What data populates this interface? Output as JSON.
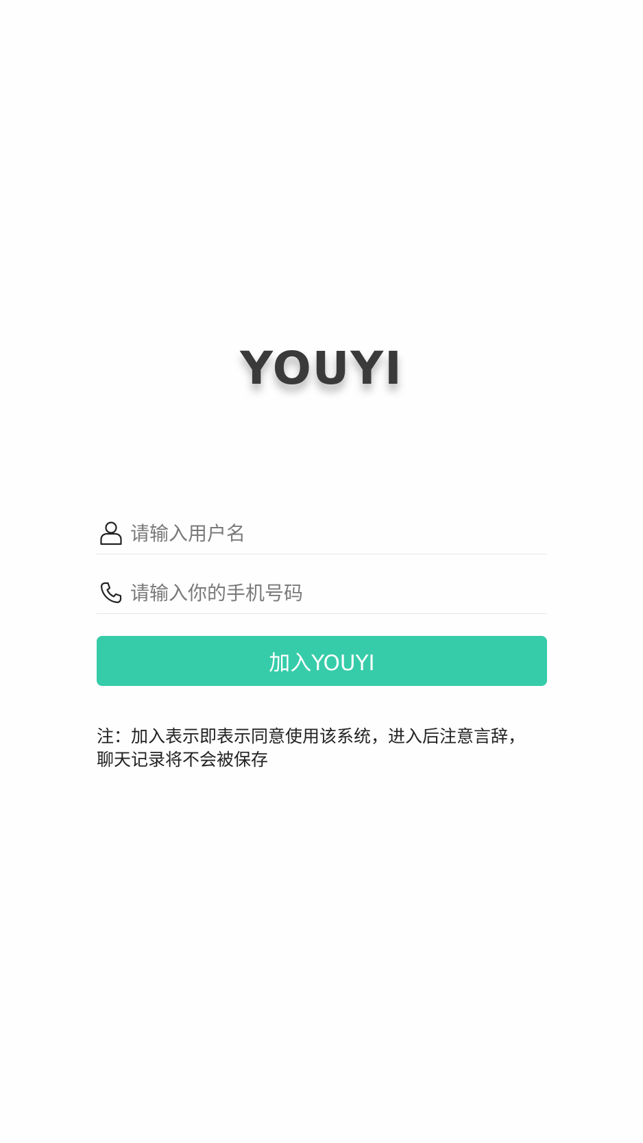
{
  "logo": {
    "text": "YOUYI"
  },
  "form": {
    "username": {
      "icon": "user-icon",
      "placeholder": "请输入用户名",
      "value": ""
    },
    "phone": {
      "icon": "phone-icon",
      "placeholder": "请输入你的手机号码",
      "value": ""
    },
    "join_button_label": "加入YOUYI"
  },
  "note": {
    "text": "注：加入表示即表示同意使用该系统，进入后注意言辞，聊天记录将不会被保存"
  },
  "colors": {
    "accent": "#36cca9",
    "logo": "#3a3a3a",
    "background": "#fefefe",
    "divider": "#e6e6e6"
  }
}
